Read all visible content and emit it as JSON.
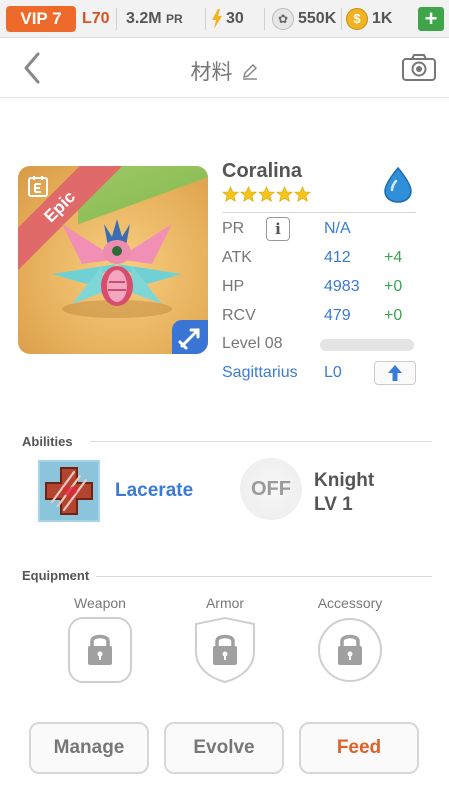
{
  "statusbar": {
    "vip": "VIP 7",
    "level": "L70",
    "pr_value": "3.2M",
    "pr_unit": "PR",
    "energy": "30",
    "paw": "550K",
    "coins": "1K",
    "plus": "+"
  },
  "header": {
    "title": "材料",
    "edit_icon": "pencil-icon",
    "back_icon": "chevron-left-icon",
    "camera_icon": "camera-icon"
  },
  "monster": {
    "rarity": "Epic",
    "name": "Coralina",
    "stars": 5,
    "element": "water",
    "stats": {
      "pr_label": "PR",
      "pr_value": "N/A",
      "atk_label": "ATK",
      "atk_value": "412",
      "atk_bonus": "+4",
      "hp_label": "HP",
      "hp_value": "4983",
      "hp_bonus": "+0",
      "rcv_label": "RCV",
      "rcv_value": "479",
      "rcv_bonus": "+0",
      "level_label": "Level 08",
      "level_progress": 0.0,
      "sign_label": "Sagittarius",
      "sign_level": "L0"
    }
  },
  "abilities": {
    "title": "Abilities",
    "active_name": "Lacerate",
    "passive_state": "OFF",
    "passive_name": "Knight",
    "passive_level": "LV 1"
  },
  "equipment": {
    "title": "Equipment",
    "slots": [
      "Weapon",
      "Armor",
      "Accessory"
    ]
  },
  "actions": {
    "manage": "Manage",
    "evolve": "Evolve",
    "feed": "Feed"
  },
  "colors": {
    "accent_blue": "#3a7bd5",
    "accent_orange": "#e0602a",
    "bonus_green": "#3aa450",
    "vip_orange": "#ee6a2b"
  }
}
